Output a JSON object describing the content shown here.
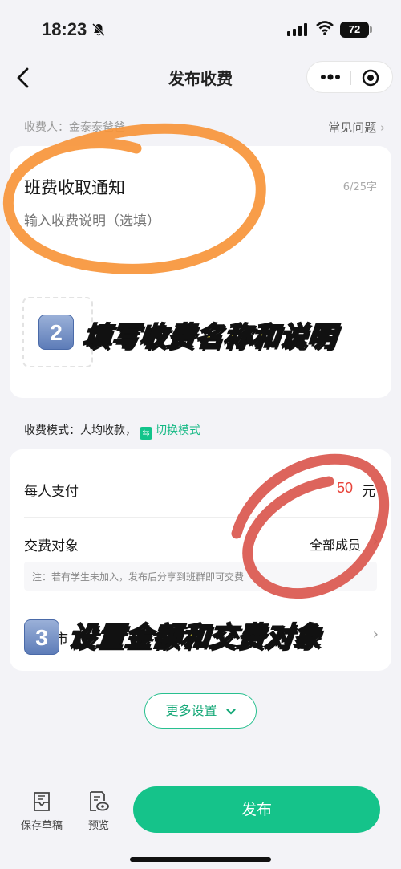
{
  "status_bar": {
    "time": "18:23",
    "battery": "72"
  },
  "nav": {
    "title": "发布收费"
  },
  "payee": {
    "label": "收费人：金泰泰爸爸",
    "faq": "常见问题"
  },
  "form": {
    "title_value": "班费收取通知",
    "char_count": "6/25字",
    "desc_placeholder": "输入收费说明（选填）"
  },
  "mode": {
    "label": "收费模式：人均收款，",
    "switch_label": "切换模式"
  },
  "payment": {
    "per_person_label": "每人支付",
    "amount": "50",
    "unit": "元",
    "payer_label": "交费对象",
    "payer_value": "全部成员",
    "note": "注：若有学生未加入，发布后分享到班群即可交费",
    "hidden_row_label": "市"
  },
  "more_settings": "更多设置",
  "bottom": {
    "draft": "保存草稿",
    "preview": "预览",
    "publish": "发布"
  },
  "overlays": {
    "step2_num": "2",
    "step2_text": "填写收费名称和说明",
    "step3_num": "3",
    "step3_text": "设置金额和交费对象"
  },
  "colors": {
    "accent": "#15c38a",
    "amount": "#e8443b",
    "orange_mark": "#f7953a",
    "red_mark": "#d9534a",
    "caption": "#fff23c"
  }
}
